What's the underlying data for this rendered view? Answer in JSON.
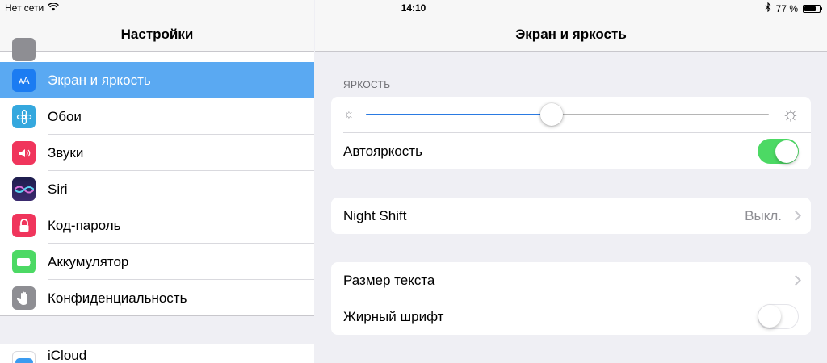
{
  "status_bar": {
    "carrier": "Нет сети",
    "wifi_icon": "wifi-icon",
    "time": "14:10",
    "bluetooth_icon": "bluetooth-icon",
    "battery_percent": "77 %",
    "battery_level": 0.77
  },
  "sidebar": {
    "title": "Настройки",
    "items": [
      {
        "label": "Экран и яркость",
        "icon": "display-brightness-icon",
        "color": "#1b7cf2",
        "selected": true
      },
      {
        "label": "Обои",
        "icon": "wallpaper-icon",
        "color": "#35a8de"
      },
      {
        "label": "Звуки",
        "icon": "sounds-icon",
        "color": "#f0355c"
      },
      {
        "label": "Siri",
        "icon": "siri-icon",
        "color": "#2c2c6e"
      },
      {
        "label": "Код-пароль",
        "icon": "passcode-lock-icon",
        "color": "#f0355c"
      },
      {
        "label": "Аккумулятор",
        "icon": "battery-icon",
        "color": "#4cd964"
      },
      {
        "label": "Конфиденциальность",
        "icon": "privacy-hand-icon",
        "color": "#8e8e93"
      }
    ],
    "icon_glyphs": {
      "display": "ᴀA"
    },
    "bottom_item": {
      "label": "iCloud",
      "icon": "icloud-icon"
    },
    "selected_color": "#5aa9f2"
  },
  "detail": {
    "title": "Экран и яркость",
    "brightness_section_label": "ЯРКОСТЬ",
    "brightness_level": 0.46,
    "auto_brightness_label": "Автояркость",
    "auto_brightness_on": true,
    "night_shift_label": "Night Shift",
    "night_shift_value": "Выкл.",
    "text_size_label": "Размер текста",
    "bold_text_label": "Жирный шрифт",
    "bold_text_on": false,
    "toggle_on_color": "#4cd964",
    "slider_color": "#2a7ae2"
  }
}
